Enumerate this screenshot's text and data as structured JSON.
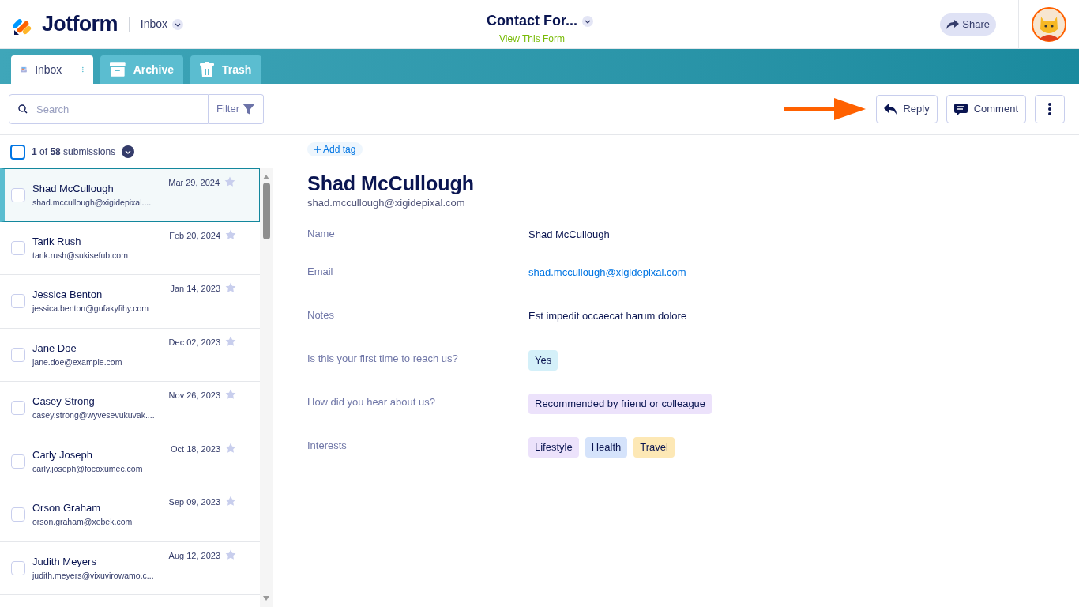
{
  "header": {
    "brand": "Jotform",
    "section": "Inbox",
    "form_title": "Contact For...",
    "view_form": "View This Form",
    "share": "Share"
  },
  "tabs": [
    {
      "label": "Inbox",
      "selected": true
    },
    {
      "label": "Archive",
      "selected": false
    },
    {
      "label": "Trash",
      "selected": false
    }
  ],
  "search": {
    "placeholder": "Search",
    "filter": "Filter"
  },
  "count": {
    "text": "**1** of **58** submissions",
    "checked": false
  },
  "submissions": [
    {
      "name": "Shad McCullough",
      "email": "shad.mccullough@xigidepixal....",
      "date": "Mar 29, 2024",
      "selected": true,
      "checked": false,
      "starred": false
    },
    {
      "name": "Tarik Rush",
      "email": "tarik.rush@sukisefub.com",
      "date": "Feb 20, 2024",
      "selected": false,
      "checked": false,
      "starred": false
    },
    {
      "name": "Jessica Benton",
      "email": "jessica.benton@gufakyfihy.com",
      "date": "Jan 14, 2023",
      "selected": false,
      "checked": false,
      "starred": false
    },
    {
      "name": "Jane Doe",
      "email": "jane.doe@example.com",
      "date": "Dec 02, 2023",
      "selected": false,
      "checked": false,
      "starred": false
    },
    {
      "name": "Casey Strong",
      "email": "casey.strong@wyvesevukuvak....",
      "date": "Nov 26, 2023",
      "selected": false,
      "checked": false,
      "starred": false
    },
    {
      "name": "Carly Joseph",
      "email": "carly.joseph@focoxumec.com",
      "date": "Oct 18, 2023",
      "selected": false,
      "checked": false,
      "starred": false
    },
    {
      "name": "Orson Graham",
      "email": "orson.graham@xebek.com",
      "date": "Sep 09, 2023",
      "selected": false,
      "checked": false,
      "starred": false
    },
    {
      "name": "Judith Meyers",
      "email": "judith.meyers@vixuvirowamo.c...",
      "date": "Aug 12, 2023",
      "selected": false,
      "checked": false,
      "starred": false
    }
  ],
  "toolbar": {
    "reply": "Reply",
    "comment": "Comment"
  },
  "detail": {
    "add_tag": "Add tag",
    "name": "Shad McCullough",
    "email": "shad.mccullough@xigidepixal.com",
    "fields": [
      {
        "label": "Name",
        "kind": "text",
        "value": "Shad McCullough"
      },
      {
        "label": "Email",
        "kind": "link",
        "value": "shad.mccullough@xigidepixal.com"
      },
      {
        "label": "Notes",
        "kind": "text",
        "value": "Est impedit occaecat harum dolore"
      },
      {
        "label": "Is this your first time to reach us?",
        "kind": "tags",
        "tags": [
          {
            "text": "Yes",
            "color": "#d4f0f9"
          }
        ]
      },
      {
        "label": "How did you hear about us?",
        "kind": "tags",
        "tags": [
          {
            "text": "Recommended by friend or colleague",
            "color": "#ece2fb"
          }
        ]
      },
      {
        "label": "Interests",
        "kind": "tags",
        "tags": [
          {
            "text": "Lifestyle",
            "color": "#ece2fb"
          },
          {
            "text": "Health",
            "color": "#d5e3fb"
          },
          {
            "text": "Travel",
            "color": "#fde8b5"
          }
        ]
      }
    ]
  }
}
